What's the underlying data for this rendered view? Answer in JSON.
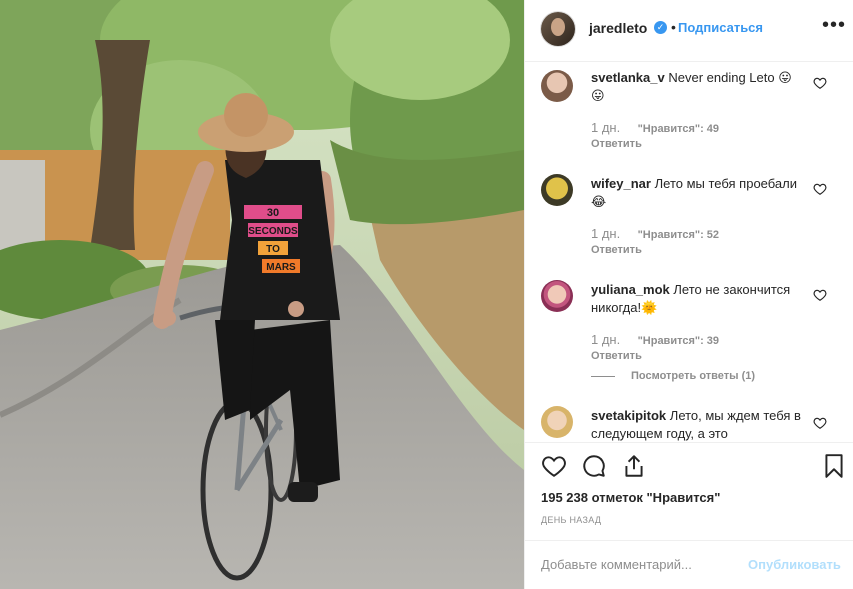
{
  "post": {
    "photo_icon": "photo-of-man-on-bicycle",
    "shirt_text": [
      "30",
      "SECONDS",
      "TO",
      "MARS"
    ]
  },
  "header": {
    "username": "jaredleto",
    "verified_icon": "verified-badge-icon",
    "separator": "•",
    "follow_label": "Подписаться",
    "more_icon": "•••"
  },
  "comments": [
    {
      "username": "svetlanka_v",
      "text": "Never ending Leto 😛😛",
      "time": "1 дн.",
      "likes": "\"Нравится\": 49",
      "reply": "Ответить"
    },
    {
      "username": "wifey_nar",
      "text": "Лето мы тебя проебали 😂",
      "time": "1 дн.",
      "likes": "\"Нравится\": 52",
      "reply": "Ответить"
    },
    {
      "username": "yuliana_mok",
      "text": "Лето не закончится никогда!🌞",
      "time": "1 дн.",
      "likes": "\"Нравится\": 39",
      "reply": "Ответить"
    },
    {
      "username": "svetakipitok",
      "text": "Лето, мы ждем тебя в следующем году, а это",
      "time": "",
      "likes": "",
      "reply": ""
    }
  ],
  "view_replies": "Посмотреть ответы (1)",
  "likes_count": "195 238 отметок \"Нравится\"",
  "date": "ДЕНЬ НАЗАД",
  "add_comment": {
    "placeholder": "Добавьте комментарий...",
    "publish_label": "Опубликовать"
  },
  "colors": {
    "link_blue": "#3897f0",
    "publish_disabled": "#b2dffc",
    "muted_text": "#8e8e8e",
    "text": "#262626",
    "divider": "#efefef"
  }
}
